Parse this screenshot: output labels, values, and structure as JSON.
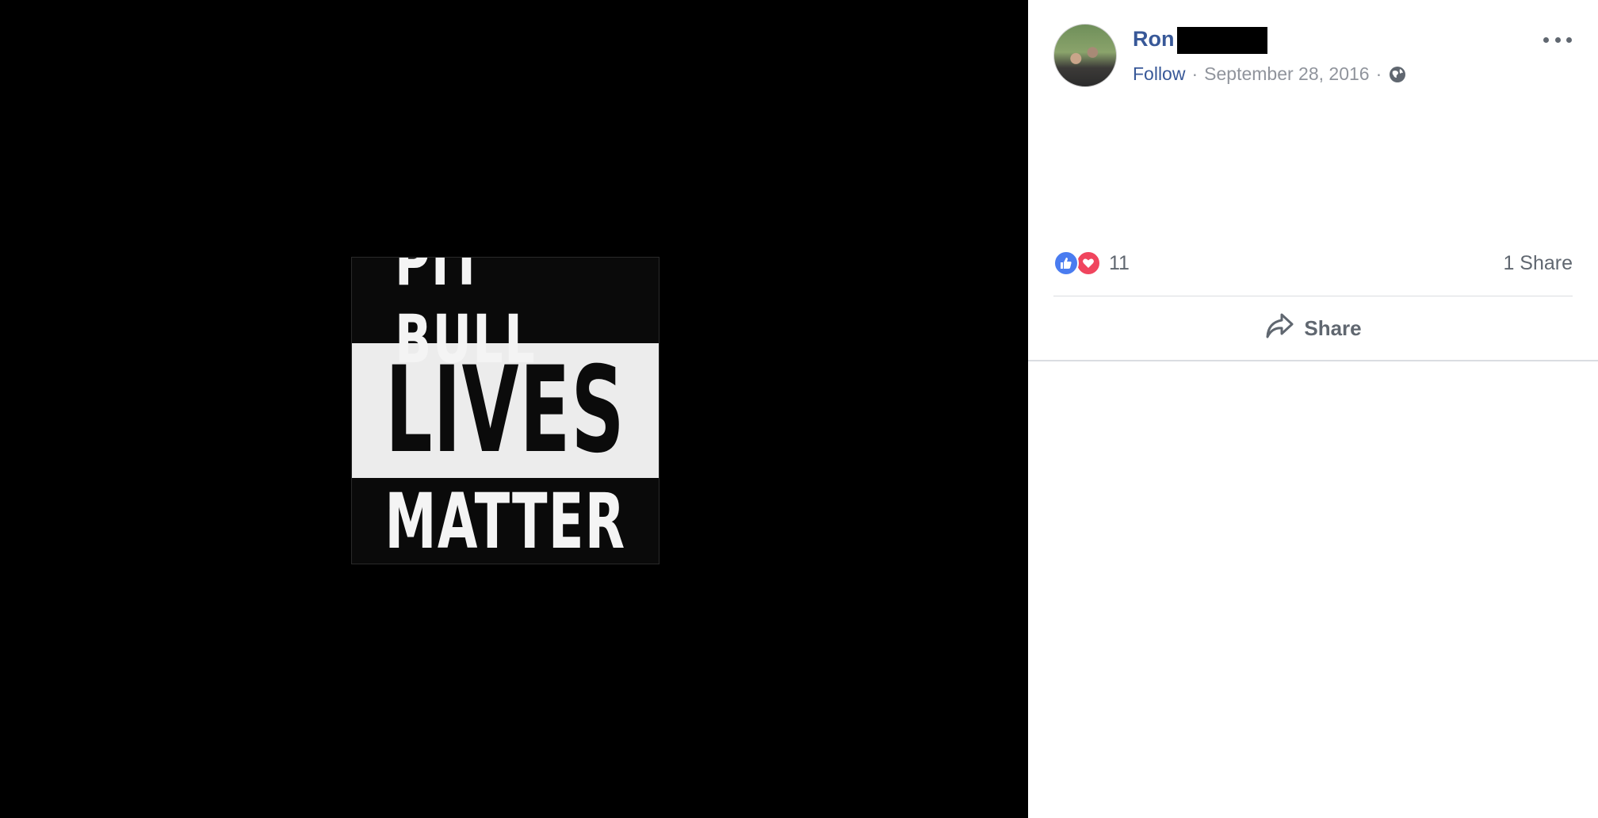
{
  "photo": {
    "line1": "PIT BULL",
    "line2": "LIVES",
    "line3": "MATTER"
  },
  "post": {
    "author": "Ron",
    "follow_label": "Follow",
    "separator": "·",
    "date": "September 28, 2016",
    "privacy_icon": "globe-icon",
    "menu_icon": "more-options-icon"
  },
  "reactions": {
    "icons": [
      "like-icon",
      "love-icon"
    ],
    "count": "11",
    "shares": "1 Share"
  },
  "actions": {
    "share_label": "Share"
  },
  "colors": {
    "link": "#385898",
    "meta": "#90949c",
    "like": "#4a7cf0",
    "love": "#f0455e"
  }
}
